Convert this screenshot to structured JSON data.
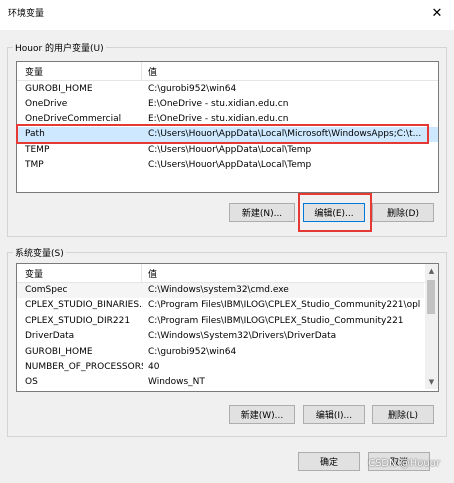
{
  "window": {
    "title": "环境变量",
    "close_glyph": "✕"
  },
  "user_vars": {
    "group_label": "Houor 的用户变量(U)",
    "col_var": "变量",
    "col_val": "值",
    "rows": [
      {
        "name": "GUROBI_HOME",
        "value": "C:\\gurobi952\\win64"
      },
      {
        "name": "OneDrive",
        "value": "E:\\OneDrive - stu.xidian.edu.cn"
      },
      {
        "name": "OneDriveCommercial",
        "value": "E:\\OneDrive - stu.xidian.edu.cn"
      },
      {
        "name": "Path",
        "value": "C:\\Users\\Houor\\AppData\\Local\\Microsoft\\WindowsApps;C:\\t..."
      },
      {
        "name": "TEMP",
        "value": "C:\\Users\\Houor\\AppData\\Local\\Temp"
      },
      {
        "name": "TMP",
        "value": "C:\\Users\\Houor\\AppData\\Local\\Temp"
      }
    ],
    "btn_new": "新建(N)...",
    "btn_edit": "编辑(E)...",
    "btn_delete": "删除(D)"
  },
  "system_vars": {
    "group_label": "系统变量(S)",
    "col_var": "变量",
    "col_val": "值",
    "rows": [
      {
        "name": "ComSpec",
        "value": "C:\\Windows\\system32\\cmd.exe"
      },
      {
        "name": "CPLEX_STUDIO_BINARIES...",
        "value": "C:\\Program Files\\IBM\\ILOG\\CPLEX_Studio_Community221\\opl..."
      },
      {
        "name": "CPLEX_STUDIO_DIR221",
        "value": "C:\\Program Files\\IBM\\ILOG\\CPLEX_Studio_Community221"
      },
      {
        "name": "DriverData",
        "value": "C:\\Windows\\System32\\Drivers\\DriverData"
      },
      {
        "name": "GUROBI_HOME",
        "value": "C:\\gurobi952\\win64"
      },
      {
        "name": "NUMBER_OF_PROCESSORS",
        "value": "40"
      },
      {
        "name": "OS",
        "value": "Windows_NT"
      }
    ],
    "btn_new": "新建(W)...",
    "btn_edit": "编辑(I)...",
    "btn_delete": "删除(L)"
  },
  "footer": {
    "ok": "确定",
    "cancel": "取消"
  },
  "watermark": "CSDN @Houor",
  "colors": {
    "highlight": "#e53935",
    "selection": "#cde8ff",
    "focus": "#0078d7"
  }
}
